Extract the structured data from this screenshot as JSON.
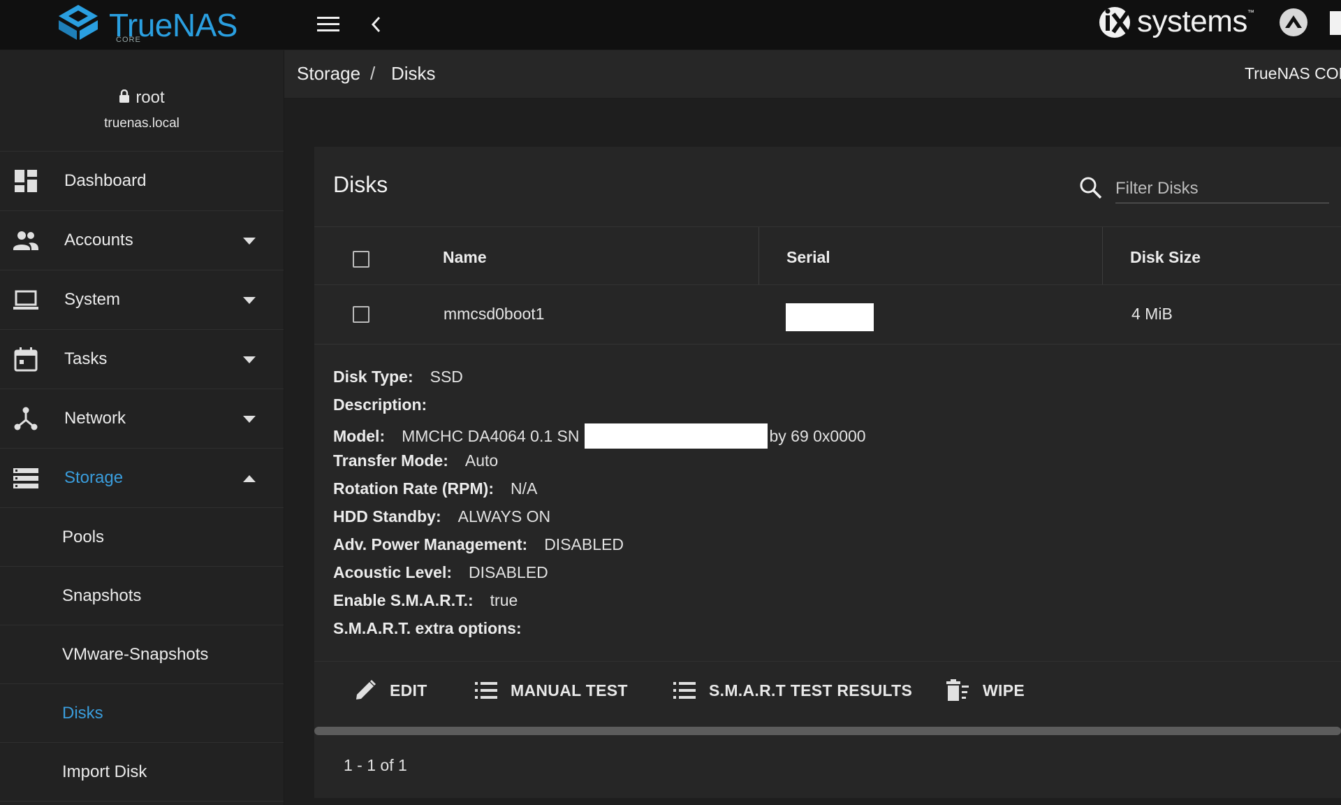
{
  "topbar": {
    "logo_text": "TrueNAS",
    "logo_sub": "CORE",
    "brand_text": "systems",
    "brand_tm": "™"
  },
  "sidebar": {
    "user": "root",
    "hostname": "truenas.local",
    "items": [
      {
        "label": "Dashboard",
        "icon": "dashboard-icon",
        "has_caret": false
      },
      {
        "label": "Accounts",
        "icon": "people-icon",
        "has_caret": true
      },
      {
        "label": "System",
        "icon": "laptop-icon",
        "has_caret": true
      },
      {
        "label": "Tasks",
        "icon": "calendar-icon",
        "has_caret": true
      },
      {
        "label": "Network",
        "icon": "network-icon",
        "has_caret": true
      },
      {
        "label": "Storage",
        "icon": "storage-icon",
        "has_caret": true,
        "expanded": true,
        "active": true
      }
    ],
    "subitems": [
      {
        "label": "Pools"
      },
      {
        "label": "Snapshots"
      },
      {
        "label": "VMware-Snapshots"
      },
      {
        "label": "Disks",
        "active": true
      },
      {
        "label": "Import Disk"
      }
    ]
  },
  "breadcrumb": {
    "parent": "Storage",
    "separator": "/",
    "current": "Disks",
    "right_text": "TrueNAS COR"
  },
  "disks": {
    "title": "Disks",
    "filter_placeholder": "Filter Disks",
    "columns": [
      "Name",
      "Serial",
      "Disk Size"
    ],
    "rows": [
      {
        "name": "mmcsd0boot1",
        "serial": "",
        "size": "4 MiB"
      }
    ],
    "details": {
      "disk_type_label": "Disk Type:",
      "disk_type": "SSD",
      "description_label": "Description:",
      "description": "",
      "model_label": "Model:",
      "model_prefix": "MMCHC DA4064 0.1 SN",
      "model_suffix": "by 69 0x0000",
      "transfer_mode_label": "Transfer Mode:",
      "transfer_mode": "Auto",
      "rotation_label": "Rotation Rate (RPM):",
      "rotation": "N/A",
      "standby_label": "HDD Standby:",
      "standby": "ALWAYS ON",
      "apm_label": "Adv. Power Management:",
      "apm": "DISABLED",
      "acoustic_label": "Acoustic Level:",
      "acoustic": "DISABLED",
      "smart_label": "Enable S.M.A.R.T.:",
      "smart": "true",
      "smart_opts_label": "S.M.A.R.T. extra options:",
      "smart_opts": ""
    },
    "actions": {
      "edit": "EDIT",
      "manual_test": "MANUAL TEST",
      "smart_results": "S.M.A.R.T TEST RESULTS",
      "wipe": "WIPE"
    },
    "paginator": "1 - 1 of 1"
  },
  "colors": {
    "accent": "#3a9ddc",
    "topbar_bg": "#101010",
    "sidebar_bg": "#222222",
    "card_bg": "#262626",
    "page_bg": "#1e1e1e"
  }
}
